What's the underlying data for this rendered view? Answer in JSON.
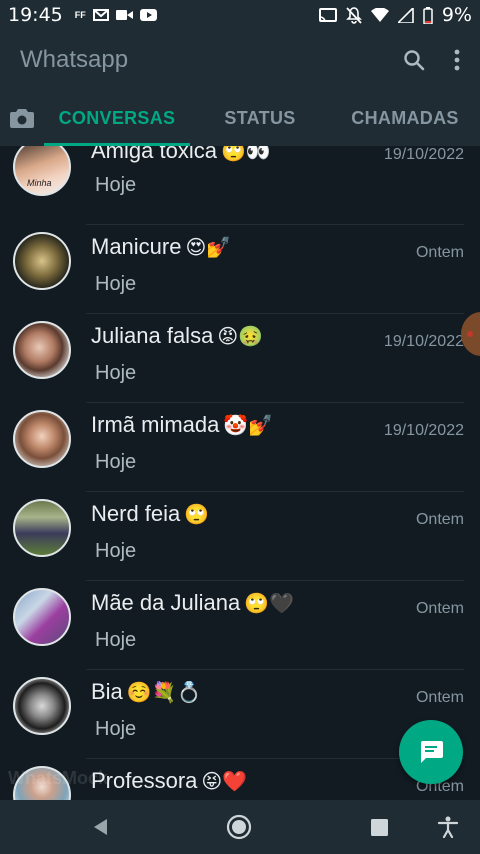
{
  "statusbar": {
    "time": "19:45",
    "notif_icons": [
      "ff-icon",
      "gmail-icon",
      "video-icon",
      "youtube-icon"
    ],
    "right_icons": [
      "cast-icon",
      "mute-icon",
      "wifi-icon",
      "signal-icon",
      "battery-icon"
    ],
    "battery_pct": "9%"
  },
  "appbar": {
    "title": "Whatsapp"
  },
  "tabs": [
    {
      "label": "CONVERSAS",
      "active": true
    },
    {
      "label": "STATUS",
      "active": false
    },
    {
      "label": "CHAMADAS",
      "active": false
    }
  ],
  "chats": [
    {
      "name": "Amiga tóxica",
      "emoji": "🙄👀",
      "preview": "Hoje",
      "date": "19/10/2022",
      "avatar_label": "Minha"
    },
    {
      "name": "Manicure",
      "emoji": "😍💅",
      "preview": "Hoje",
      "date": "Ontem",
      "avatar_label": ""
    },
    {
      "name": "Juliana falsa",
      "emoji": "😡🤢",
      "preview": "Hoje",
      "date": "19/10/2022",
      "avatar_label": ""
    },
    {
      "name": "Irmã mimada",
      "emoji": "🤡💅",
      "preview": "Hoje",
      "date": "19/10/2022",
      "avatar_label": ""
    },
    {
      "name": "Nerd feia",
      "emoji": "🙄",
      "preview": "Hoje",
      "date": "Ontem",
      "avatar_label": ""
    },
    {
      "name": "Mãe da Juliana",
      "emoji": "🙄🖤",
      "preview": "Hoje",
      "date": "Ontem",
      "avatar_label": ""
    },
    {
      "name": "Bia",
      "emoji": "☺️💐💍",
      "preview": "Hoje",
      "date": "Ontem",
      "avatar_label": ""
    },
    {
      "name": "Professora",
      "emoji": "😝❤️",
      "preview": "",
      "date": "Ontem",
      "avatar_label": ""
    }
  ],
  "watermark": "WhatsMock",
  "colors": {
    "accent": "#00a884",
    "bar": "#1f2c34",
    "background": "#121b22"
  }
}
